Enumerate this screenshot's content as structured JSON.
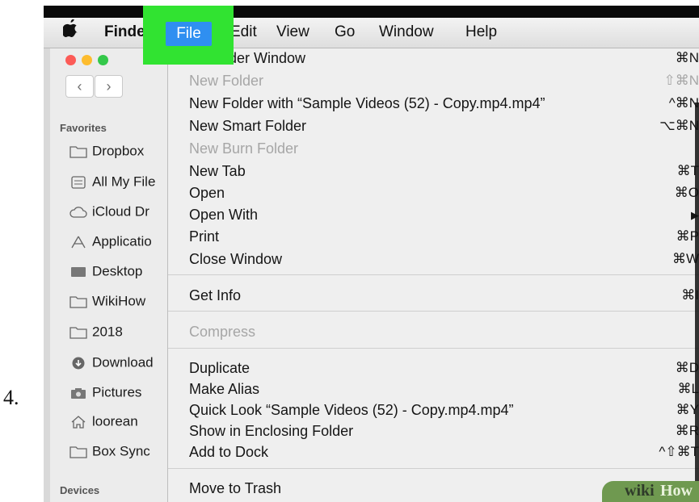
{
  "step_number": "4.",
  "menubar": {
    "apple_icon": "apple-logo-icon",
    "items": [
      "Finde",
      "File",
      "Edit",
      "View",
      "Go",
      "Window",
      "Help"
    ],
    "highlight_color": "#31e331",
    "selected_color": "#2f8ff1"
  },
  "window": {
    "traffic_lights": [
      "#fc5b57",
      "#fdbc2e",
      "#34c84a"
    ],
    "back_glyph": "‹",
    "forward_glyph": "›"
  },
  "sidebar": {
    "favorites_heading": "Favorites",
    "items": [
      {
        "label": "Dropbox",
        "icon": "folder-icon"
      },
      {
        "label": "All My File",
        "icon": "all-files-icon"
      },
      {
        "label": "iCloud Dr",
        "icon": "cloud-icon"
      },
      {
        "label": "Applicatio",
        "icon": "applications-icon"
      },
      {
        "label": "Desktop",
        "icon": "desktop-icon"
      },
      {
        "label": "WikiHow",
        "icon": "folder-icon"
      },
      {
        "label": "2018",
        "icon": "folder-icon"
      },
      {
        "label": "Download",
        "icon": "download-icon"
      },
      {
        "label": "Pictures",
        "icon": "camera-icon"
      },
      {
        "label": "loorean",
        "icon": "home-icon"
      },
      {
        "label": "Box Sync",
        "icon": "folder-icon"
      }
    ],
    "devices_heading": "Devices"
  },
  "file_menu": {
    "items": [
      {
        "label": "Finder Window",
        "shortcut": "⌘N",
        "enabled": true
      },
      {
        "label": "New Folder",
        "shortcut": "⇧⌘N",
        "enabled": false
      },
      {
        "label": "New Folder with “Sample Videos (52) - Copy.mp4.mp4”",
        "shortcut": "^⌘N",
        "enabled": true
      },
      {
        "label": "New Smart Folder",
        "shortcut": "⌥⌘N",
        "enabled": true
      },
      {
        "label": "New Burn Folder",
        "shortcut": "",
        "enabled": false
      },
      {
        "label": "New Tab",
        "shortcut": "⌘T",
        "enabled": true
      },
      {
        "label": "Open",
        "shortcut": "⌘O",
        "enabled": true
      },
      {
        "label": "Open With",
        "shortcut": "▶",
        "enabled": true
      },
      {
        "label": "Print",
        "shortcut": "⌘P",
        "enabled": true
      },
      {
        "label": "Close Window",
        "shortcut": "⌘W",
        "enabled": true
      },
      {
        "label": "Get Info",
        "shortcut": "⌘I",
        "enabled": true
      },
      {
        "label": "Compress",
        "shortcut": "",
        "enabled": false
      },
      {
        "label": "Duplicate",
        "shortcut": "⌘D",
        "enabled": true
      },
      {
        "label": "Make Alias",
        "shortcut": "⌘L",
        "enabled": true
      },
      {
        "label": "Quick Look “Sample Videos (52) - Copy.mp4.mp4”",
        "shortcut": "⌘Y",
        "enabled": true
      },
      {
        "label": "Show in Enclosing Folder",
        "shortcut": "⌘R",
        "enabled": true
      },
      {
        "label": "Add to Dock",
        "shortcut": "^⇧⌘T",
        "enabled": true
      },
      {
        "label": "Move to Trash",
        "shortcut": "",
        "enabled": true
      }
    ]
  },
  "watermark": {
    "part1": "wiki",
    "part2": "How"
  }
}
